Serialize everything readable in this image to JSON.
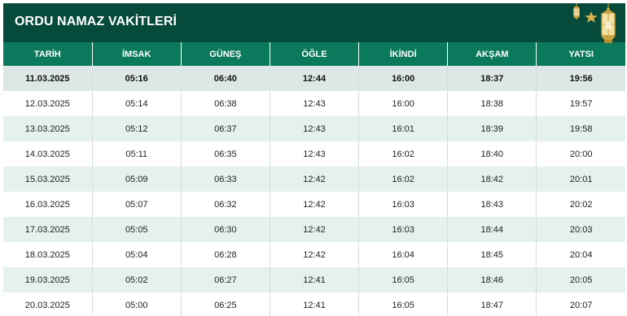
{
  "header": {
    "title": "ORDU NAMAZ VAKİTLERİ"
  },
  "colors": {
    "title_bg": "#054a3a",
    "header_bg": "#0b7a5c",
    "alt_row": "#e4f1ef",
    "today_row": "#dde8e6",
    "lantern_gold": "#c9a23c"
  },
  "icons": [
    "lantern-icon",
    "star-icon",
    "lantern-icon"
  ],
  "table": {
    "columns": [
      "TARİH",
      "İMSAK",
      "GÜNEŞ",
      "ÖĞLE",
      "İKİNDİ",
      "AKŞAM",
      "YATSI"
    ],
    "rows": [
      [
        "11.03.2025",
        "05:16",
        "06:40",
        "12:44",
        "16:00",
        "18:37",
        "19:56"
      ],
      [
        "12.03.2025",
        "05:14",
        "06:38",
        "12:43",
        "16:00",
        "18:38",
        "19:57"
      ],
      [
        "13.03.2025",
        "05:12",
        "06:37",
        "12:43",
        "16:01",
        "18:39",
        "19:58"
      ],
      [
        "14.03.2025",
        "05:11",
        "06:35",
        "12:43",
        "16:02",
        "18:40",
        "20:00"
      ],
      [
        "15.03.2025",
        "05:09",
        "06:33",
        "12:42",
        "16:02",
        "18:42",
        "20:01"
      ],
      [
        "16.03.2025",
        "05:07",
        "06:32",
        "12:42",
        "16:03",
        "18:43",
        "20:02"
      ],
      [
        "17.03.2025",
        "05:05",
        "06:30",
        "12:42",
        "16:03",
        "18:44",
        "20:03"
      ],
      [
        "18.03.2025",
        "05:04",
        "06:28",
        "12:42",
        "16:04",
        "18:45",
        "20:04"
      ],
      [
        "19.03.2025",
        "05:02",
        "06:27",
        "12:41",
        "16:05",
        "18:46",
        "20:05"
      ],
      [
        "20.03.2025",
        "05:00",
        "06:25",
        "12:41",
        "16:05",
        "18:47",
        "20:07"
      ]
    ]
  }
}
